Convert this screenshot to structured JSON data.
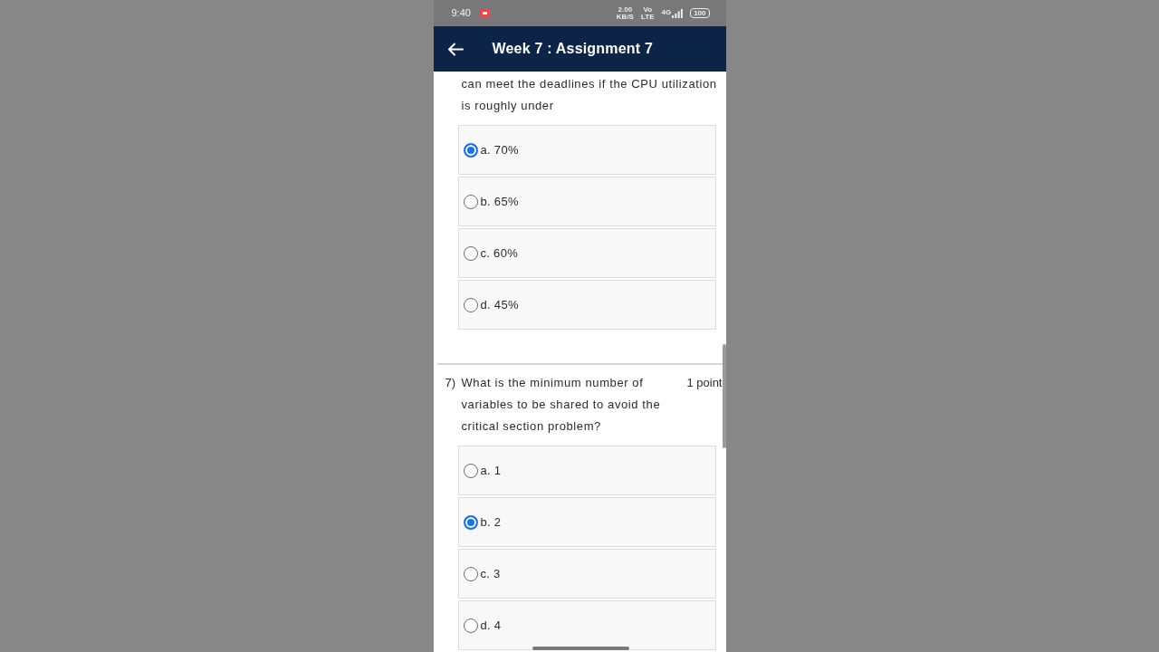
{
  "status_bar": {
    "time": "9:40",
    "speed": "2.00",
    "speed_unit": "KB/S",
    "volte_top": "Vo",
    "volte_bottom": "LTE",
    "network": "4G",
    "battery": "100"
  },
  "app_bar": {
    "title": "Week 7 : Assignment 7"
  },
  "questions": [
    {
      "text": "can meet the deadlines if the CPU utilization is roughly under",
      "options": [
        {
          "label": "a. 70%",
          "selected": true
        },
        {
          "label": "b. 65%",
          "selected": false
        },
        {
          "label": "c. 60%",
          "selected": false
        },
        {
          "label": "d. 45%",
          "selected": false
        }
      ]
    },
    {
      "number": "7)",
      "text": "What is the minimum number of variables to be shared to avoid the critical section problem?",
      "points": "1 point",
      "options": [
        {
          "label": "a. 1",
          "selected": false
        },
        {
          "label": "b. 2",
          "selected": true
        },
        {
          "label": "c. 3",
          "selected": false
        },
        {
          "label": "d. 4",
          "selected": false
        }
      ]
    }
  ]
}
